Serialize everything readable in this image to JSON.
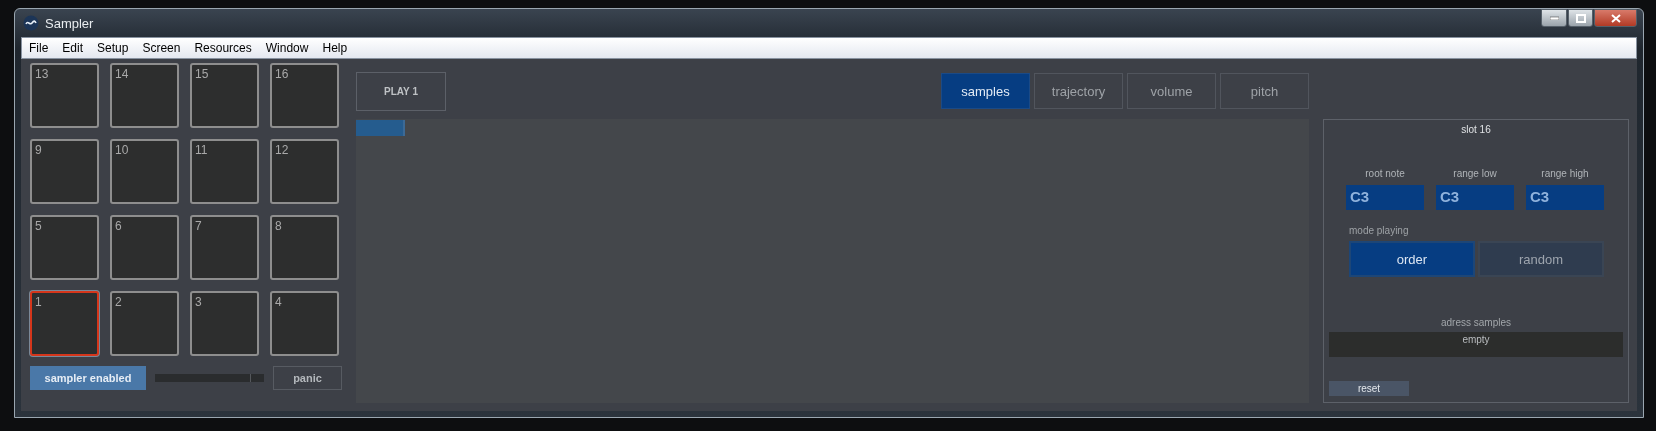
{
  "window": {
    "title": "Sampler"
  },
  "menu": [
    "File",
    "Edit",
    "Setup",
    "Screen",
    "Resources",
    "Window",
    "Help"
  ],
  "pads": [
    {
      "label": "13",
      "selected": false
    },
    {
      "label": "14",
      "selected": false
    },
    {
      "label": "15",
      "selected": false
    },
    {
      "label": "16",
      "selected": false
    },
    {
      "label": "9",
      "selected": false
    },
    {
      "label": "10",
      "selected": false
    },
    {
      "label": "11",
      "selected": false
    },
    {
      "label": "12",
      "selected": false
    },
    {
      "label": "5",
      "selected": false
    },
    {
      "label": "6",
      "selected": false
    },
    {
      "label": "7",
      "selected": false
    },
    {
      "label": "8",
      "selected": false
    },
    {
      "label": "1",
      "selected": true
    },
    {
      "label": "2",
      "selected": false
    },
    {
      "label": "3",
      "selected": false
    },
    {
      "label": "4",
      "selected": false
    }
  ],
  "sampler_toggle": {
    "label": "sampler enabled",
    "on": true
  },
  "panic_button": "panic",
  "play_button": "PLAY 1",
  "tabs": [
    {
      "label": "samples",
      "selected": true
    },
    {
      "label": "trajectory",
      "selected": false
    },
    {
      "label": "volume",
      "selected": false
    },
    {
      "label": "pitch",
      "selected": false
    }
  ],
  "slot_panel": {
    "title": "slot 16",
    "fields": [
      {
        "label": "root note",
        "value": "C3"
      },
      {
        "label": "range low",
        "value": "C3"
      },
      {
        "label": "range high",
        "value": "C3"
      }
    ],
    "mode": {
      "label": "mode playing",
      "options": [
        {
          "label": "order",
          "selected": true
        },
        {
          "label": "random",
          "selected": false
        }
      ]
    },
    "address": {
      "label": "adress samples",
      "value": "empty"
    },
    "reset_button": "reset"
  }
}
